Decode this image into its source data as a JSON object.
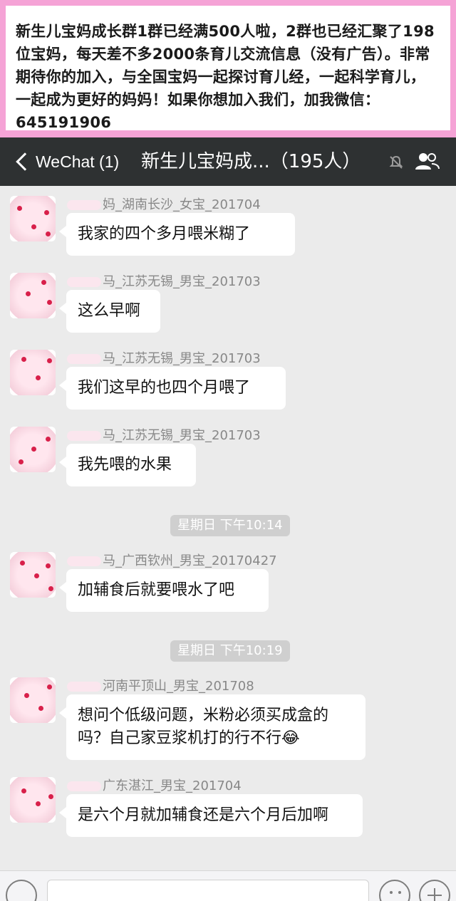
{
  "banner": {
    "text": "新生儿宝妈成长群1群已经满500人啦，2群也已经汇聚了198位宝妈，每天差不多2000条育儿交流信息（没有广告）。非常期待你的加入，与全国宝妈一起探讨育儿经，一起科学育儿，一起成为更好的妈妈！如果你想加入我们，加我微信：645191906"
  },
  "navbar": {
    "back_label": "WeChat (1)",
    "title": "新生儿宝妈成...（195人）"
  },
  "messages": [
    {
      "nick": "妈_湖南长沙_女宝_201704",
      "text": "我家的四个多月喂米糊了"
    },
    {
      "nick": "马_江苏无锡_男宝_201703",
      "text": "这么早啊"
    },
    {
      "nick": "马_江苏无锡_男宝_201703",
      "text": "我们这早的也四个月喂了"
    },
    {
      "nick": "马_江苏无锡_男宝_201703",
      "text": "我先喂的水果"
    },
    {
      "nick": "马_广西钦州_男宝_20170427",
      "text": "加辅食后就要喂水了吧"
    },
    {
      "nick": "河南平顶山_男宝_201708",
      "text": "想问个低级问题，米粉必须买成盒的吗？自己家豆浆机打的行不行😂"
    },
    {
      "nick": "广东湛江_男宝_201704",
      "text": " 是六个月就加辅食还是六个月后加啊"
    }
  ],
  "timestamps": [
    "星期日 下午10:14",
    "星期日 下午10:19"
  ],
  "colors": {
    "banner_border": "#f5a3d6",
    "navbar_bg": "#2e3132",
    "chat_bg": "#ebebeb",
    "bubble_bg": "#ffffff",
    "timestamp_bg": "#cfcfcf",
    "cherry": "#d8204a"
  },
  "icons": [
    "back-chevron-icon",
    "mute-bell-icon",
    "group-members-icon",
    "voice-icon",
    "emoji-icon",
    "plus-icon"
  ]
}
